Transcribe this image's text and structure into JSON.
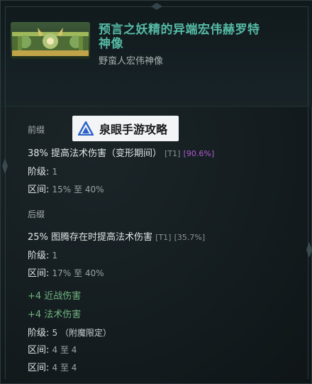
{
  "item": {
    "title_line1": "预言之妖精的异端宏伟赫罗特",
    "title_line2": "神像",
    "subtitle": "野蛮人宏伟神像"
  },
  "watermark": {
    "text": "泉眼手游攻略"
  },
  "prefix": {
    "section_label": "前缀",
    "affix_text": "38% 提高法术伤害（变形期间）",
    "tier": "[T1]",
    "roll_pct": "[90.6%]",
    "level_label": "阶级:",
    "level_value": "1",
    "range_label": "区间:",
    "range_value": "15% 至 40%"
  },
  "suffix": {
    "section_label": "后缀",
    "affix_text": "25% 图腾存在时提高法术伤害",
    "tier": "[T1]",
    "roll_pct": "[35.7%]",
    "level_label": "阶级:",
    "level_value": "1",
    "range_label": "区间:",
    "range_value": "17% 至 40%"
  },
  "implicit": {
    "line1": "+4 近战伤害",
    "line2": "+4 法术伤害",
    "level_label": "阶级:",
    "level_value": "5 （附魔限定）",
    "range1_label": "区间:",
    "range1_value": "4 至 4",
    "range2_label": "区间:",
    "range2_value": "4 至 4"
  },
  "colors": {
    "title": "#55b9a4",
    "roll_high": "#b55bd6",
    "implicit": "#71b480"
  }
}
